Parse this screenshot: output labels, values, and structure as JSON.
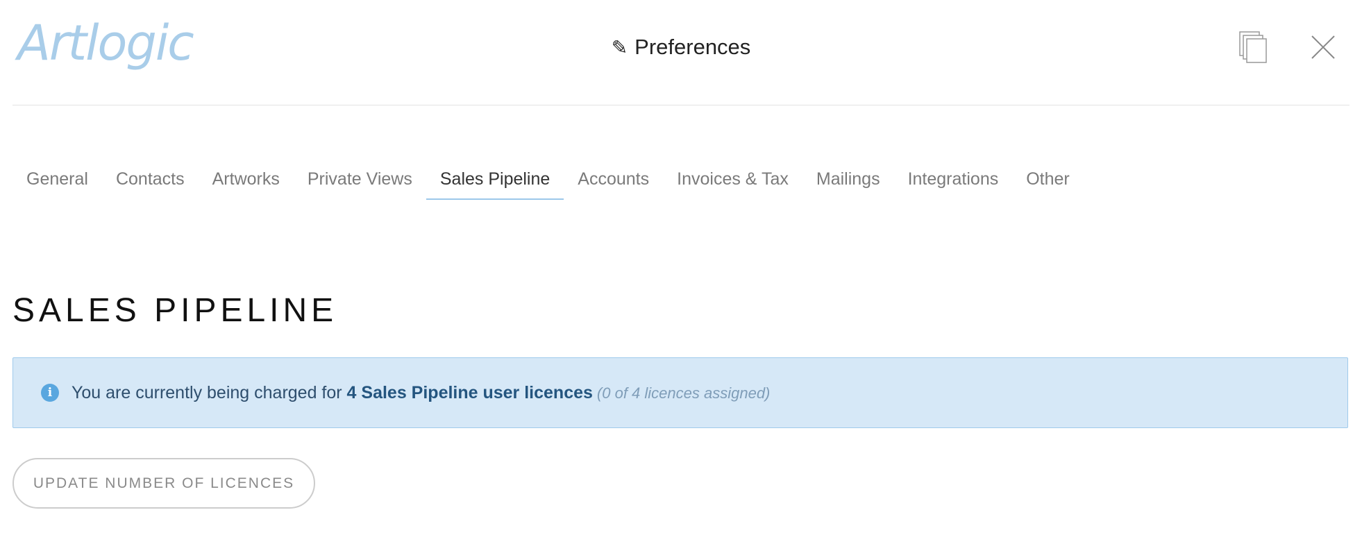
{
  "header": {
    "logo_text": "Artlogic",
    "title": "Preferences",
    "title_icon": "pencil-icon",
    "copy_icon": "copy-icon",
    "close_icon": "close-icon"
  },
  "tabs": [
    {
      "label": "General",
      "active": false
    },
    {
      "label": "Contacts",
      "active": false
    },
    {
      "label": "Artworks",
      "active": false
    },
    {
      "label": "Private Views",
      "active": false
    },
    {
      "label": "Sales Pipeline",
      "active": true
    },
    {
      "label": "Accounts",
      "active": false
    },
    {
      "label": "Invoices & Tax",
      "active": false
    },
    {
      "label": "Mailings",
      "active": false
    },
    {
      "label": "Integrations",
      "active": false
    },
    {
      "label": "Other",
      "active": false
    }
  ],
  "section": {
    "title": "SALES PIPELINE"
  },
  "banner": {
    "icon": "info-icon",
    "text_prefix": "You are currently being charged for ",
    "text_strong": "4 Sales Pipeline user licences",
    "text_note": "(0 of 4 licences assigned)"
  },
  "actions": {
    "update_label": "UPDATE NUMBER OF LICENCES"
  },
  "colors": {
    "logo": "#a9cde9",
    "tab_underline": "#9cc8ea",
    "banner_bg": "#d6e8f7",
    "banner_border": "#9fcaec",
    "info_icon": "#5aa7df",
    "banner_strong": "#24557f"
  }
}
